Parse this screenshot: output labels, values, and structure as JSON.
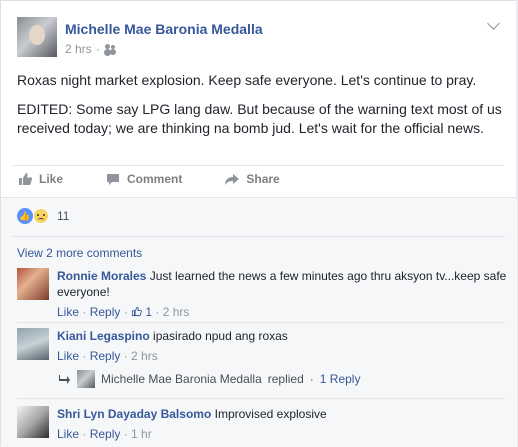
{
  "post": {
    "author": "Michelle Mae Baronia Medalla",
    "timestamp": "2 hrs",
    "privacy_icon": "friends-icon",
    "paragraphs": [
      "Roxas night market explosion. Keep safe everyone. Let's continue to pray.",
      "EDITED: Some say LPG lang daw. But because of the warning text most of us received today; we are thinking na bomb jud. Let's wait for the official news."
    ]
  },
  "actions": {
    "like": "Like",
    "comment": "Comment",
    "share": "Share"
  },
  "reactions": {
    "count": "11"
  },
  "comments": {
    "view_more": "View 2 more comments",
    "items": [
      {
        "name": "Ronnie Morales",
        "text": "Just learned the news a few minutes ago thru aksyon tv...keep safe everyone!",
        "like": "Like",
        "reply": "Reply",
        "likes": "1",
        "time": "2 hrs"
      },
      {
        "name": "Kiani Legaspino",
        "text": "ipasirado npud ang roxas",
        "like": "Like",
        "reply": "Reply",
        "time": "2 hrs"
      },
      {
        "name": "Shri Lyn Dayaday Balsomo",
        "text": "Improvised explosive",
        "like": "Like",
        "reply": "Reply",
        "time": "1 hr"
      }
    ],
    "reply_summary": {
      "name": "Michelle Mae Baronia Medalla",
      "replied": "replied",
      "link": "1 Reply"
    }
  },
  "colors": {
    "link_blue": "#365899",
    "muted": "#90949c",
    "comment_bg": "#f6f7f9"
  }
}
